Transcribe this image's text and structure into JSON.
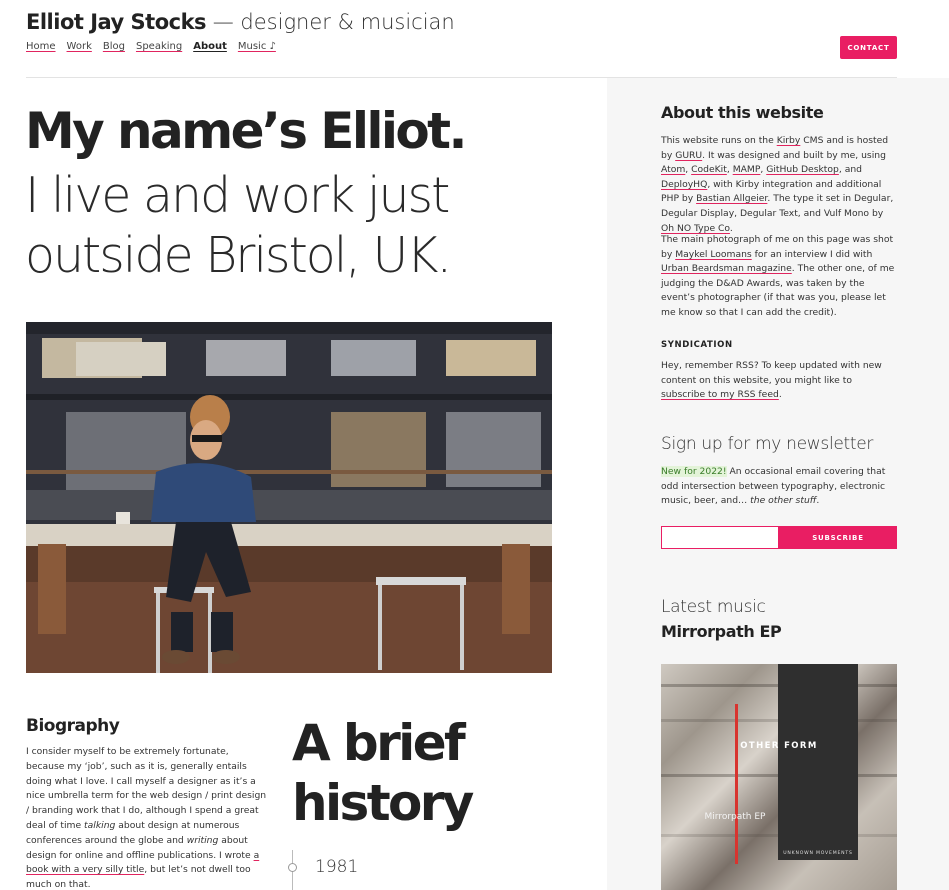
{
  "header": {
    "site_name": "Elliot Jay Stocks",
    "tagline": " — designer & musician",
    "nav": [
      {
        "label": "Home",
        "active": false
      },
      {
        "label": "Work",
        "active": false
      },
      {
        "label": "Blog",
        "active": false
      },
      {
        "label": "Speaking",
        "active": false
      },
      {
        "label": "About",
        "active": true
      },
      {
        "label": "Music ♪",
        "active": false
      }
    ],
    "contact_label": "CONTACT"
  },
  "hero": {
    "line1": "My name’s Elliot.",
    "line2": "I live and work just outside Bristol, UK."
  },
  "biography": {
    "heading": "Biography",
    "text_a": "I consider myself to be extremely fortunate, because my ‘job’, such as it is, generally entails doing what I love. I call myself a designer as it’s a nice umbrella term for the web design / print design / branding work that I do, although I spend a great deal of time ",
    "em1": "talking",
    "text_b": " about design at numerous conferences around the globe and ",
    "em2": "writing",
    "text_c": " about design for online and offline publications. I wrote ",
    "link": "a book with a very silly title",
    "text_d": ", but let’s not dwell too much on that."
  },
  "history": {
    "heading": "A brief history",
    "year": "1981"
  },
  "sidebar": {
    "about": {
      "heading": "About this website",
      "p1": [
        {
          "t": "This website runs on the ",
          "link": false
        },
        {
          "t": "Kirby",
          "link": true
        },
        {
          "t": " CMS and is hosted by ",
          "link": false
        },
        {
          "t": "GURU",
          "link": true
        },
        {
          "t": ". It was designed and built by me, using ",
          "link": false
        },
        {
          "t": "Atom",
          "link": true
        },
        {
          "t": ", ",
          "link": false
        },
        {
          "t": "CodeKit",
          "link": true
        },
        {
          "t": ", ",
          "link": false
        },
        {
          "t": "MAMP",
          "link": true
        },
        {
          "t": ", ",
          "link": false
        },
        {
          "t": "GitHub Desktop",
          "link": true
        },
        {
          "t": ", and ",
          "link": false
        },
        {
          "t": "DeployHQ",
          "link": true
        },
        {
          "t": ", with Kirby integration and additional PHP by ",
          "link": false
        },
        {
          "t": "Bastian Allgeier",
          "link": true
        },
        {
          "t": ". The type it set in Degular, Degular Display, Degular Text, and Vulf Mono by ",
          "link": false
        },
        {
          "t": "Oh NO Type Co",
          "link": true
        },
        {
          "t": ".",
          "link": false
        }
      ],
      "p2": [
        {
          "t": "The main photograph of me on this page was shot by ",
          "link": false
        },
        {
          "t": "Maykel Loomans",
          "link": true
        },
        {
          "t": " for an interview I did with ",
          "link": false
        },
        {
          "t": "Urban Beardsman magazine",
          "link": true
        },
        {
          "t": ". The other one, of me judging the D&AD Awards, was taken by the event’s photographer (if that was you, please let me know so that I can add the credit).",
          "link": false
        }
      ]
    },
    "syndication": {
      "heading": "SYNDICATION",
      "text": "Hey, remember RSS? To keep updated with new content on this website, you might like to ",
      "link": "subscribe to my RSS feed",
      "end": "."
    },
    "newsletter": {
      "heading": "Sign up for my newsletter",
      "badge": "New for 2022!",
      "text": " An occasional email covering that odd intersection between typography, electronic music, beer, and… ",
      "em": "the other stuff",
      "end": ".",
      "input_placeholder": "",
      "button": "SUBSCRIBE"
    },
    "music": {
      "heading": "Latest music",
      "title": "Mirrorpath EP",
      "cover_artist": "OTHER FORM",
      "cover_title": "Mirrorpath EP",
      "cover_label": "UNKNOWN MOVEMENTS"
    }
  },
  "colors": {
    "accent": "#e91e63",
    "sidebar_bg": "#f6f6f6",
    "text": "#222222"
  }
}
